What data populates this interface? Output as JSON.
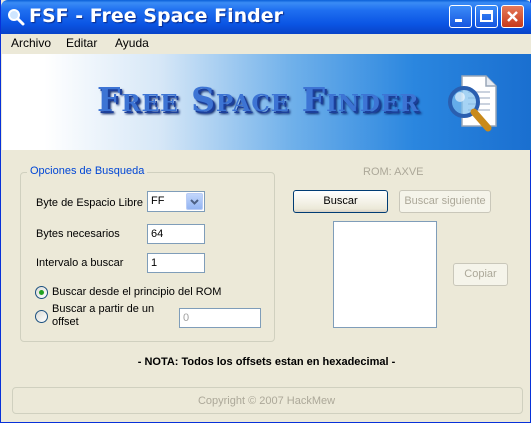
{
  "window": {
    "title": "FSF - Free Space Finder",
    "icon": "magnifier-app-icon"
  },
  "menu": {
    "items": [
      "Archivo",
      "Editar",
      "Ayuda"
    ]
  },
  "banner": {
    "logo_text": "Free Space Finder",
    "icon": "document-magnifier-icon"
  },
  "options": {
    "group_title": "Opciones de Busqueda",
    "byte_label": "Byte de Espacio Libre",
    "byte_value": "FF",
    "bytes_needed_label": "Bytes necesarios",
    "bytes_needed_value": "64",
    "interval_label": "Intervalo a buscar",
    "interval_value": "1",
    "radio_start_label": "Buscar desde el principio del ROM",
    "radio_start_checked": true,
    "radio_offset_label_1": "Buscar a partir de un",
    "radio_offset_label_2": "offset",
    "radio_offset_checked": false,
    "offset_value": "0"
  },
  "search": {
    "rom_label": "ROM: AXVE",
    "search_button": "Buscar",
    "search_next_button": "Buscar siguiente",
    "copy_button": "Copiar"
  },
  "note": "- NOTA: Todos los offsets estan en hexadecimal -",
  "footer": "Copyright © 2007 HackMew",
  "colors": {
    "title_bar": "#0b55e4",
    "group_title": "#0046d5",
    "disabled_text": "#aca899",
    "window_bg": "#ece9d8"
  }
}
